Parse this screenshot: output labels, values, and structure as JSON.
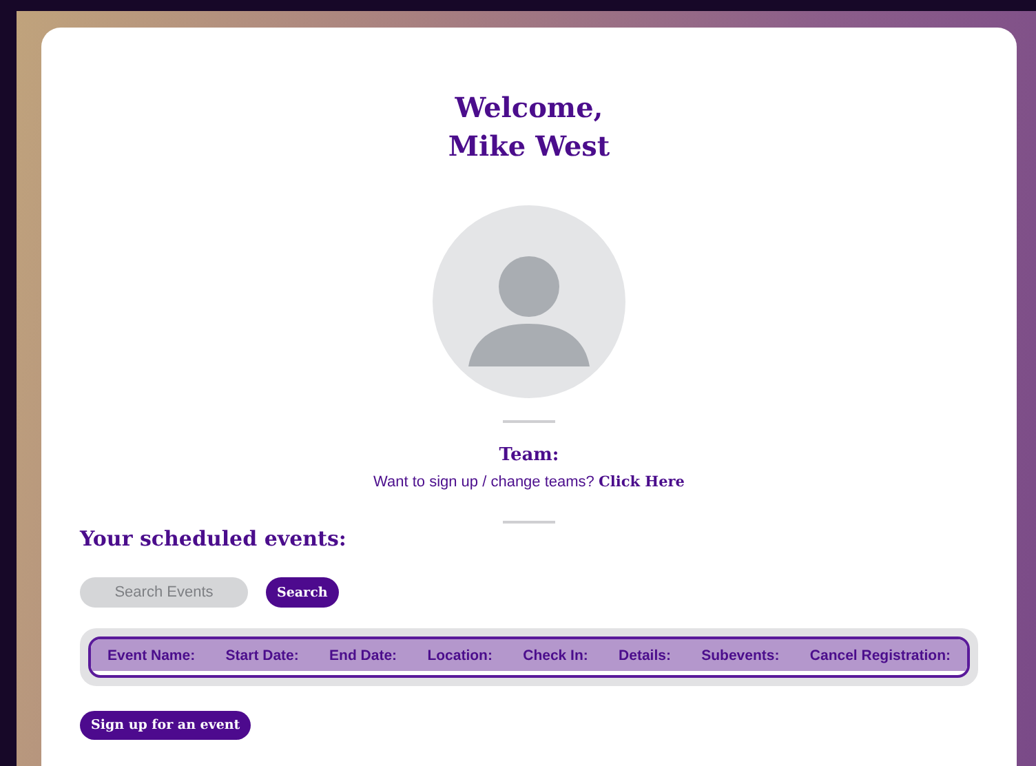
{
  "greeting": {
    "line1": "Welcome,",
    "line2": "Mike West"
  },
  "team": {
    "heading": "Team:",
    "prompt": "Want to sign up / change teams?",
    "link": "Click Here"
  },
  "events": {
    "heading": "Your scheduled events:",
    "search": {
      "placeholder": "Search Events",
      "button": "Search"
    },
    "table": {
      "columns": [
        "Event Name:",
        "Start Date:",
        "End Date:",
        "Location:",
        "Check In:",
        "Details:",
        "Subevents:",
        "Cancel Registration:"
      ]
    },
    "signup_button": "Sign up for an event"
  }
}
